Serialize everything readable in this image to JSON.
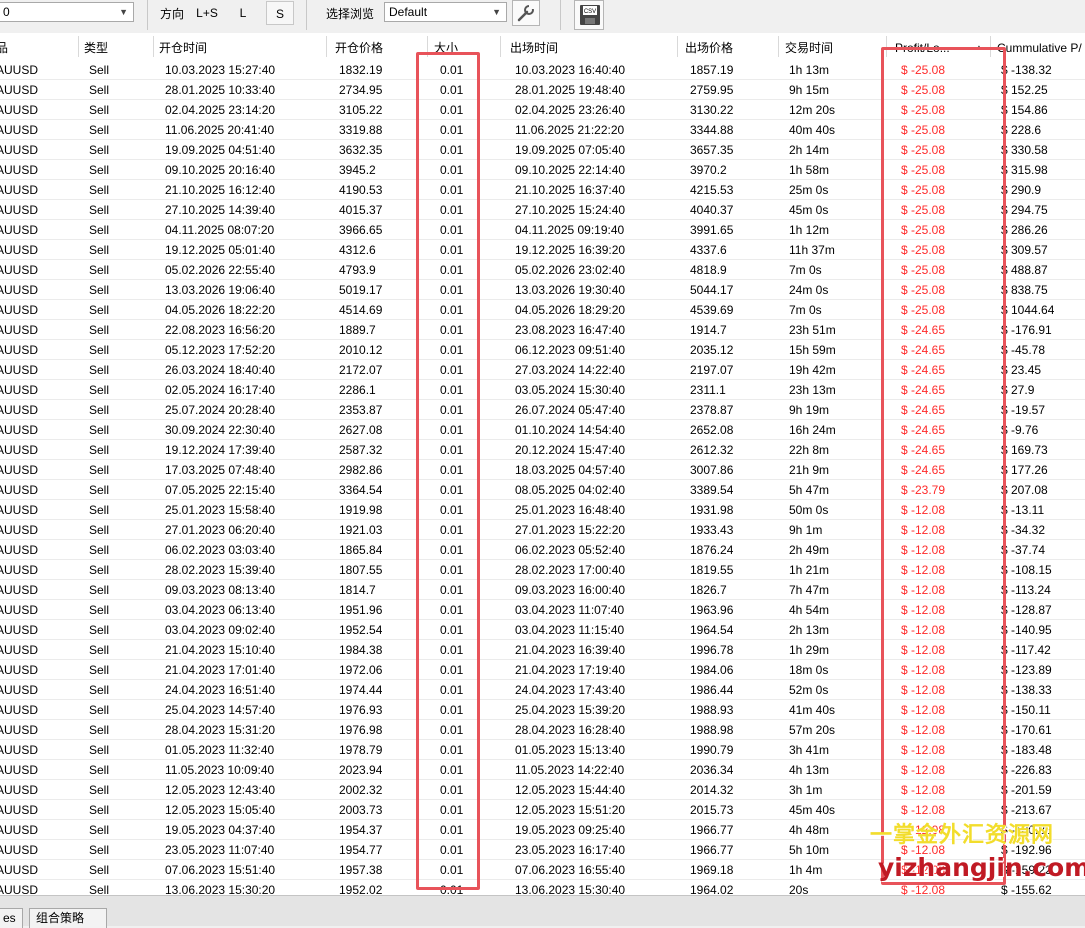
{
  "toolbar": {
    "strategy_value": "0",
    "direction_label": "方向",
    "direction_ls": "L+S",
    "direction_l": "L",
    "direction_s": "S",
    "browse_label": "选择浏览",
    "browse_value": "Default",
    "tools_icon": "wrench-icon",
    "csv_icon": "csv-export-icon",
    "csv_text": "CSV"
  },
  "columns": {
    "symbol": "品",
    "type": "类型",
    "open_time": "开仓时间",
    "open_price": "开仓价格",
    "size": "大小",
    "close_time": "出场时间",
    "close_price": "出场价格",
    "duration": "交易时间",
    "profit": "Profit/Lo...",
    "sort_arrow": "▲",
    "cumulative": "Cummulative P/"
  },
  "rows": [
    [
      "AUUSD",
      "Sell",
      "10.03.2023 15:27:40",
      "1832.19",
      "0.01",
      "10.03.2023 16:40:40",
      "1857.19",
      "1h 13m",
      "$ -25.08",
      "$ -138.32"
    ],
    [
      "AUUSD",
      "Sell",
      "28.01.2025 10:33:40",
      "2734.95",
      "0.01",
      "28.01.2025 19:48:40",
      "2759.95",
      "9h 15m",
      "$ -25.08",
      "$ 152.25"
    ],
    [
      "AUUSD",
      "Sell",
      "02.04.2025 23:14:20",
      "3105.22",
      "0.01",
      "02.04.2025 23:26:40",
      "3130.22",
      "12m 20s",
      "$ -25.08",
      "$ 154.86"
    ],
    [
      "AUUSD",
      "Sell",
      "11.06.2025 20:41:40",
      "3319.88",
      "0.01",
      "11.06.2025 21:22:20",
      "3344.88",
      "40m 40s",
      "$ -25.08",
      "$ 228.6"
    ],
    [
      "AUUSD",
      "Sell",
      "19.09.2025 04:51:40",
      "3632.35",
      "0.01",
      "19.09.2025 07:05:40",
      "3657.35",
      "2h 14m",
      "$ -25.08",
      "$ 330.58"
    ],
    [
      "AUUSD",
      "Sell",
      "09.10.2025 20:16:40",
      "3945.2",
      "0.01",
      "09.10.2025 22:14:40",
      "3970.2",
      "1h 58m",
      "$ -25.08",
      "$ 315.98"
    ],
    [
      "AUUSD",
      "Sell",
      "21.10.2025 16:12:40",
      "4190.53",
      "0.01",
      "21.10.2025 16:37:40",
      "4215.53",
      "25m 0s",
      "$ -25.08",
      "$ 290.9"
    ],
    [
      "AUUSD",
      "Sell",
      "27.10.2025 14:39:40",
      "4015.37",
      "0.01",
      "27.10.2025 15:24:40",
      "4040.37",
      "45m 0s",
      "$ -25.08",
      "$ 294.75"
    ],
    [
      "AUUSD",
      "Sell",
      "04.11.2025 08:07:20",
      "3966.65",
      "0.01",
      "04.11.2025 09:19:40",
      "3991.65",
      "1h 12m",
      "$ -25.08",
      "$ 286.26"
    ],
    [
      "AUUSD",
      "Sell",
      "19.12.2025 05:01:40",
      "4312.6",
      "0.01",
      "19.12.2025 16:39:20",
      "4337.6",
      "11h 37m",
      "$ -25.08",
      "$ 309.57"
    ],
    [
      "AUUSD",
      "Sell",
      "05.02.2026 22:55:40",
      "4793.9",
      "0.01",
      "05.02.2026 23:02:40",
      "4818.9",
      "7m 0s",
      "$ -25.08",
      "$ 488.87"
    ],
    [
      "AUUSD",
      "Sell",
      "13.03.2026 19:06:40",
      "5019.17",
      "0.01",
      "13.03.2026 19:30:40",
      "5044.17",
      "24m 0s",
      "$ -25.08",
      "$ 838.75"
    ],
    [
      "AUUSD",
      "Sell",
      "04.05.2026 18:22:20",
      "4514.69",
      "0.01",
      "04.05.2026 18:29:20",
      "4539.69",
      "7m 0s",
      "$ -25.08",
      "$ 1044.64"
    ],
    [
      "AUUSD",
      "Sell",
      "22.08.2023 16:56:20",
      "1889.7",
      "0.01",
      "23.08.2023 16:47:40",
      "1914.7",
      "23h 51m",
      "$ -24.65",
      "$ -176.91"
    ],
    [
      "AUUSD",
      "Sell",
      "05.12.2023 17:52:20",
      "2010.12",
      "0.01",
      "06.12.2023 09:51:40",
      "2035.12",
      "15h 59m",
      "$ -24.65",
      "$ -45.78"
    ],
    [
      "AUUSD",
      "Sell",
      "26.03.2024 18:40:40",
      "2172.07",
      "0.01",
      "27.03.2024 14:22:40",
      "2197.07",
      "19h 42m",
      "$ -24.65",
      "$ 23.45"
    ],
    [
      "AUUSD",
      "Sell",
      "02.05.2024 16:17:40",
      "2286.1",
      "0.01",
      "03.05.2024 15:30:40",
      "2311.1",
      "23h 13m",
      "$ -24.65",
      "$ 27.9"
    ],
    [
      "AUUSD",
      "Sell",
      "25.07.2024 20:28:40",
      "2353.87",
      "0.01",
      "26.07.2024 05:47:40",
      "2378.87",
      "9h 19m",
      "$ -24.65",
      "$ -19.57"
    ],
    [
      "AUUSD",
      "Sell",
      "30.09.2024 22:30:40",
      "2627.08",
      "0.01",
      "01.10.2024 14:54:40",
      "2652.08",
      "16h 24m",
      "$ -24.65",
      "$ -9.76"
    ],
    [
      "AUUSD",
      "Sell",
      "19.12.2024 17:39:40",
      "2587.32",
      "0.01",
      "20.12.2024 15:47:40",
      "2612.32",
      "22h 8m",
      "$ -24.65",
      "$ 169.73"
    ],
    [
      "AUUSD",
      "Sell",
      "17.03.2025 07:48:40",
      "2982.86",
      "0.01",
      "18.03.2025 04:57:40",
      "3007.86",
      "21h 9m",
      "$ -24.65",
      "$ 177.26"
    ],
    [
      "AUUSD",
      "Sell",
      "07.05.2025 22:15:40",
      "3364.54",
      "0.01",
      "08.05.2025 04:02:40",
      "3389.54",
      "5h 47m",
      "$ -23.79",
      "$ 207.08"
    ],
    [
      "AUUSD",
      "Sell",
      "25.01.2023 15:58:40",
      "1919.98",
      "0.01",
      "25.01.2023 16:48:40",
      "1931.98",
      "50m 0s",
      "$ -12.08",
      "$ -13.11"
    ],
    [
      "AUUSD",
      "Sell",
      "27.01.2023 06:20:40",
      "1921.03",
      "0.01",
      "27.01.2023 15:22:20",
      "1933.43",
      "9h 1m",
      "$ -12.08",
      "$ -34.32"
    ],
    [
      "AUUSD",
      "Sell",
      "06.02.2023 03:03:40",
      "1865.84",
      "0.01",
      "06.02.2023 05:52:40",
      "1876.24",
      "2h 49m",
      "$ -12.08",
      "$ -37.74"
    ],
    [
      "AUUSD",
      "Sell",
      "28.02.2023 15:39:40",
      "1807.55",
      "0.01",
      "28.02.2023 17:00:40",
      "1819.55",
      "1h 21m",
      "$ -12.08",
      "$ -108.15"
    ],
    [
      "AUUSD",
      "Sell",
      "09.03.2023 08:13:40",
      "1814.7",
      "0.01",
      "09.03.2023 16:00:40",
      "1826.7",
      "7h 47m",
      "$ -12.08",
      "$ -113.24"
    ],
    [
      "AUUSD",
      "Sell",
      "03.04.2023 06:13:40",
      "1951.96",
      "0.01",
      "03.04.2023 11:07:40",
      "1963.96",
      "4h 54m",
      "$ -12.08",
      "$ -128.87"
    ],
    [
      "AUUSD",
      "Sell",
      "03.04.2023 09:02:40",
      "1952.54",
      "0.01",
      "03.04.2023 11:15:40",
      "1964.54",
      "2h 13m",
      "$ -12.08",
      "$ -140.95"
    ],
    [
      "AUUSD",
      "Sell",
      "21.04.2023 15:10:40",
      "1984.38",
      "0.01",
      "21.04.2023 16:39:40",
      "1996.78",
      "1h 29m",
      "$ -12.08",
      "$ -117.42"
    ],
    [
      "AUUSD",
      "Sell",
      "21.04.2023 17:01:40",
      "1972.06",
      "0.01",
      "21.04.2023 17:19:40",
      "1984.06",
      "18m 0s",
      "$ -12.08",
      "$ -123.89"
    ],
    [
      "AUUSD",
      "Sell",
      "24.04.2023 16:51:40",
      "1974.44",
      "0.01",
      "24.04.2023 17:43:40",
      "1986.44",
      "52m 0s",
      "$ -12.08",
      "$ -138.33"
    ],
    [
      "AUUSD",
      "Sell",
      "25.04.2023 14:57:40",
      "1976.93",
      "0.01",
      "25.04.2023 15:39:20",
      "1988.93",
      "41m 40s",
      "$ -12.08",
      "$ -150.11"
    ],
    [
      "AUUSD",
      "Sell",
      "28.04.2023 15:31:20",
      "1976.98",
      "0.01",
      "28.04.2023 16:28:40",
      "1988.98",
      "57m 20s",
      "$ -12.08",
      "$ -170.61"
    ],
    [
      "AUUSD",
      "Sell",
      "01.05.2023 11:32:40",
      "1978.79",
      "0.01",
      "01.05.2023 15:13:40",
      "1990.79",
      "3h 41m",
      "$ -12.08",
      "$ -183.48"
    ],
    [
      "AUUSD",
      "Sell",
      "11.05.2023 10:09:40",
      "2023.94",
      "0.01",
      "11.05.2023 14:22:40",
      "2036.34",
      "4h 13m",
      "$ -12.08",
      "$ -226.83"
    ],
    [
      "AUUSD",
      "Sell",
      "12.05.2023 12:43:40",
      "2002.32",
      "0.01",
      "12.05.2023 15:44:40",
      "2014.32",
      "3h 1m",
      "$ -12.08",
      "$ -201.59"
    ],
    [
      "AUUSD",
      "Sell",
      "12.05.2023 15:05:40",
      "2003.73",
      "0.01",
      "12.05.2023 15:51:20",
      "2015.73",
      "45m 40s",
      "$ -12.08",
      "$ -213.67"
    ],
    [
      "AUUSD",
      "Sell",
      "19.05.2023 04:37:40",
      "1954.37",
      "0.01",
      "19.05.2023 09:25:40",
      "1966.77",
      "4h 48m",
      "$ -12.08",
      "$ -180.88"
    ],
    [
      "AUUSD",
      "Sell",
      "23.05.2023 11:07:40",
      "1954.77",
      "0.01",
      "23.05.2023 16:17:40",
      "1966.77",
      "5h 10m",
      "$ -12.08",
      "$ -192.96"
    ],
    [
      "AUUSD",
      "Sell",
      "07.06.2023 15:51:40",
      "1957.38",
      "0.01",
      "07.06.2023 16:55:40",
      "1969.18",
      "1h 4m",
      "$ -12.08",
      "$ -159.22"
    ],
    [
      "AUUSD",
      "Sell",
      "13.06.2023 15:30:20",
      "1952.02",
      "0.01",
      "13.06.2023 15:30:40",
      "1964.02",
      "20s",
      "$ -12.08",
      "$ -155.62"
    ]
  ],
  "tabs": [
    "es",
    "组合策略"
  ],
  "watermark": {
    "line1": "一掌金外汇资源网",
    "line2": "yizhangjin.com"
  },
  "colors": {
    "profit_negative": "#ff2a2a",
    "highlight_box": "#e8535a"
  }
}
